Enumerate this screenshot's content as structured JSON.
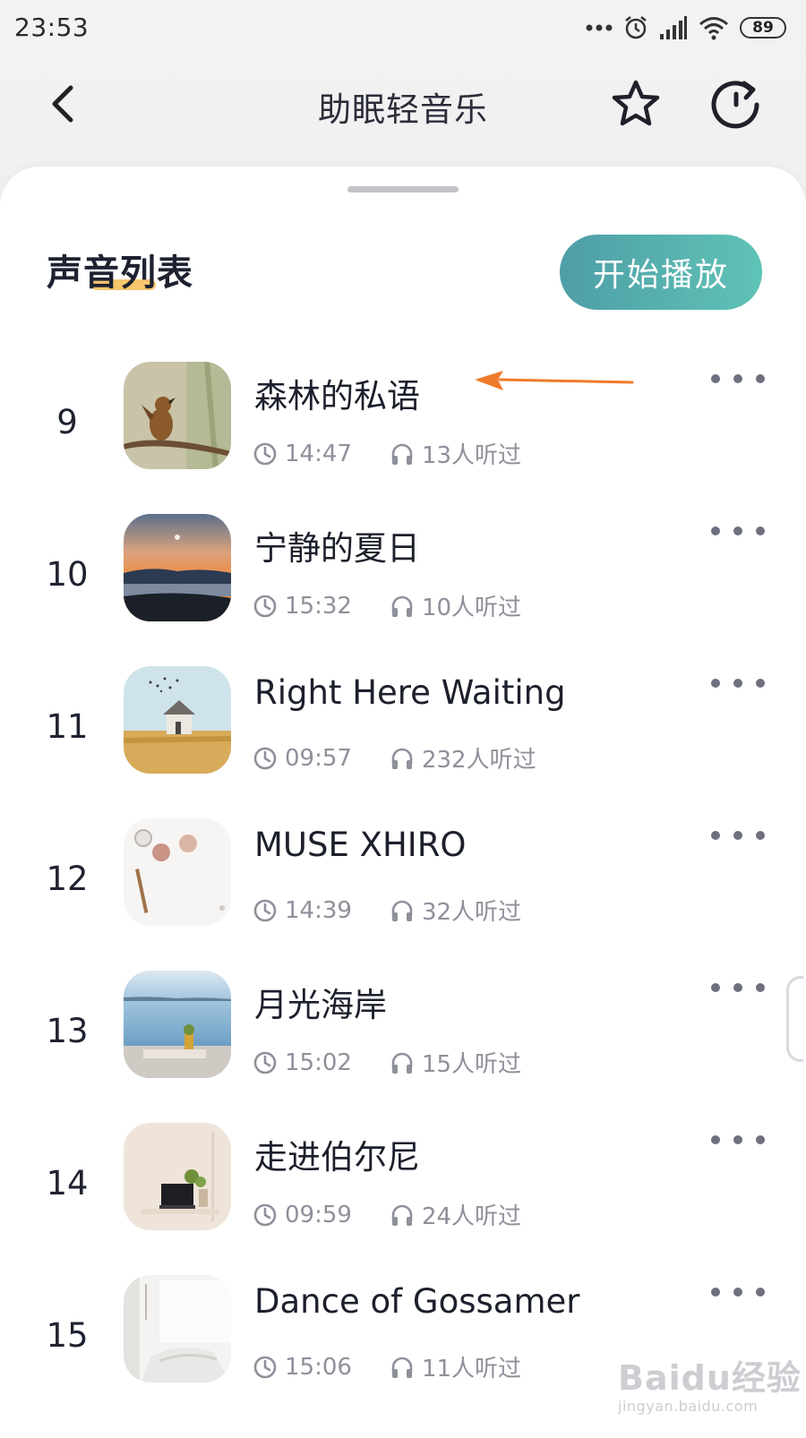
{
  "status_bar": {
    "time": "23:53",
    "battery": "89"
  },
  "header": {
    "title": "助眠轻音乐"
  },
  "list_header": {
    "title": "声音列表",
    "play_all_label": "开始播放"
  },
  "tracks": [
    {
      "index": "9",
      "title": "森林的私语",
      "duration": "14:47",
      "listens": "13人听过",
      "cover": "bird"
    },
    {
      "index": "10",
      "title": "宁静的夏日",
      "duration": "15:32",
      "listens": "10人听过",
      "cover": "sunset"
    },
    {
      "index": "11",
      "title": "Right Here Waiting",
      "duration": "09:57",
      "listens": "232人听过",
      "cover": "field-house"
    },
    {
      "index": "12",
      "title": "MUSE XHIRO",
      "duration": "14:39",
      "listens": "32人听过",
      "cover": "desk-items"
    },
    {
      "index": "13",
      "title": "月光海岸",
      "duration": "15:02",
      "listens": "15人听过",
      "cover": "seaside"
    },
    {
      "index": "14",
      "title": "走进伯尔尼",
      "duration": "09:59",
      "listens": "24人听过",
      "cover": "room-laptop"
    },
    {
      "index": "15",
      "title": "Dance of Gossamer",
      "duration": "15:06",
      "listens": "11人听过",
      "cover": "bedroom"
    }
  ],
  "watermark": {
    "logo": "Baidu经验",
    "site": "jingyan.baidu.com"
  },
  "colors": {
    "accent_start": "#4e9ea6",
    "accent_end": "#5fc3b6",
    "annotation_arrow": "#f07a2b",
    "title_underline": "#f7c66d"
  }
}
